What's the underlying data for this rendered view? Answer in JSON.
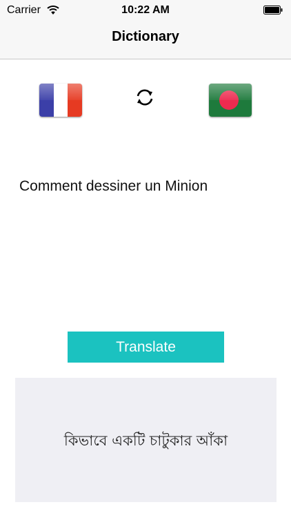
{
  "status_bar": {
    "carrier": "Carrier",
    "time": "10:22 AM",
    "icons": [
      "wifi-icon",
      "battery-icon"
    ]
  },
  "nav": {
    "title": "Dictionary"
  },
  "languages": {
    "source_flag": "france-flag-icon",
    "swap_icon": "swap-arrows-icon",
    "target_flag": "bangladesh-flag-icon"
  },
  "source": {
    "text": "Comment dessiner un Minion"
  },
  "actions": {
    "translate_label": "Translate"
  },
  "result": {
    "text": "কিভাবে একটি চাটুকার আঁকা"
  },
  "colors": {
    "accent": "#1bc2c0",
    "result_background": "#efeff4",
    "bar_background": "#f7f7f7"
  }
}
